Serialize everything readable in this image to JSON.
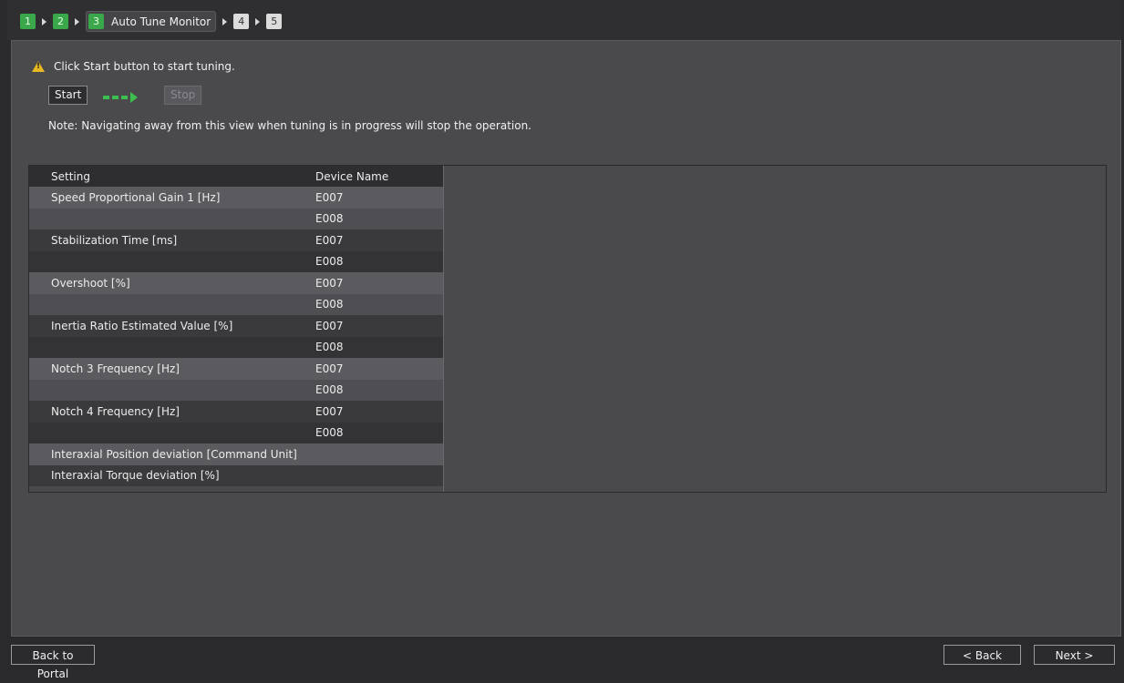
{
  "stepper": {
    "steps": [
      {
        "num": "1",
        "state": "done"
      },
      {
        "num": "2",
        "state": "done"
      },
      {
        "num": "3",
        "state": "current",
        "label": "Auto Tune Monitor"
      },
      {
        "num": "4",
        "state": "todo"
      },
      {
        "num": "5",
        "state": "todo"
      }
    ]
  },
  "hint": {
    "icon": "warning-icon",
    "text": "Click Start button to start tuning."
  },
  "controls": {
    "start_label": "Start",
    "stop_label": "Stop"
  },
  "note": "Note: Navigating away from this view when tuning is in progress will stop the operation.",
  "table": {
    "headers": [
      "Setting",
      "Device Name"
    ],
    "rows": [
      {
        "setting": "Speed Proportional Gain 1 [Hz]",
        "device": "E007"
      },
      {
        "setting": "",
        "device": "E008"
      },
      {
        "setting": "Stabilization Time [ms]",
        "device": "E007"
      },
      {
        "setting": "",
        "device": "E008"
      },
      {
        "setting": "Overshoot [%]",
        "device": "E007"
      },
      {
        "setting": "",
        "device": "E008"
      },
      {
        "setting": "Inertia Ratio Estimated Value [%]",
        "device": "E007"
      },
      {
        "setting": "",
        "device": "E008"
      },
      {
        "setting": "Notch 3 Frequency [Hz]",
        "device": "E007"
      },
      {
        "setting": "",
        "device": "E008"
      },
      {
        "setting": "Notch 4 Frequency [Hz]",
        "device": "E007"
      },
      {
        "setting": "",
        "device": "E008"
      },
      {
        "setting": "Interaxial Position deviation [Command Unit]",
        "device": ""
      },
      {
        "setting": "Interaxial Torque deviation [%]",
        "device": ""
      }
    ]
  },
  "footer": {
    "back_to_portal": "Back to Portal",
    "back": "< Back",
    "next": "Next >"
  },
  "colors": {
    "step_done": "#3aa84a",
    "arrow": "#3cbf4e",
    "warning": "#e8b820"
  }
}
